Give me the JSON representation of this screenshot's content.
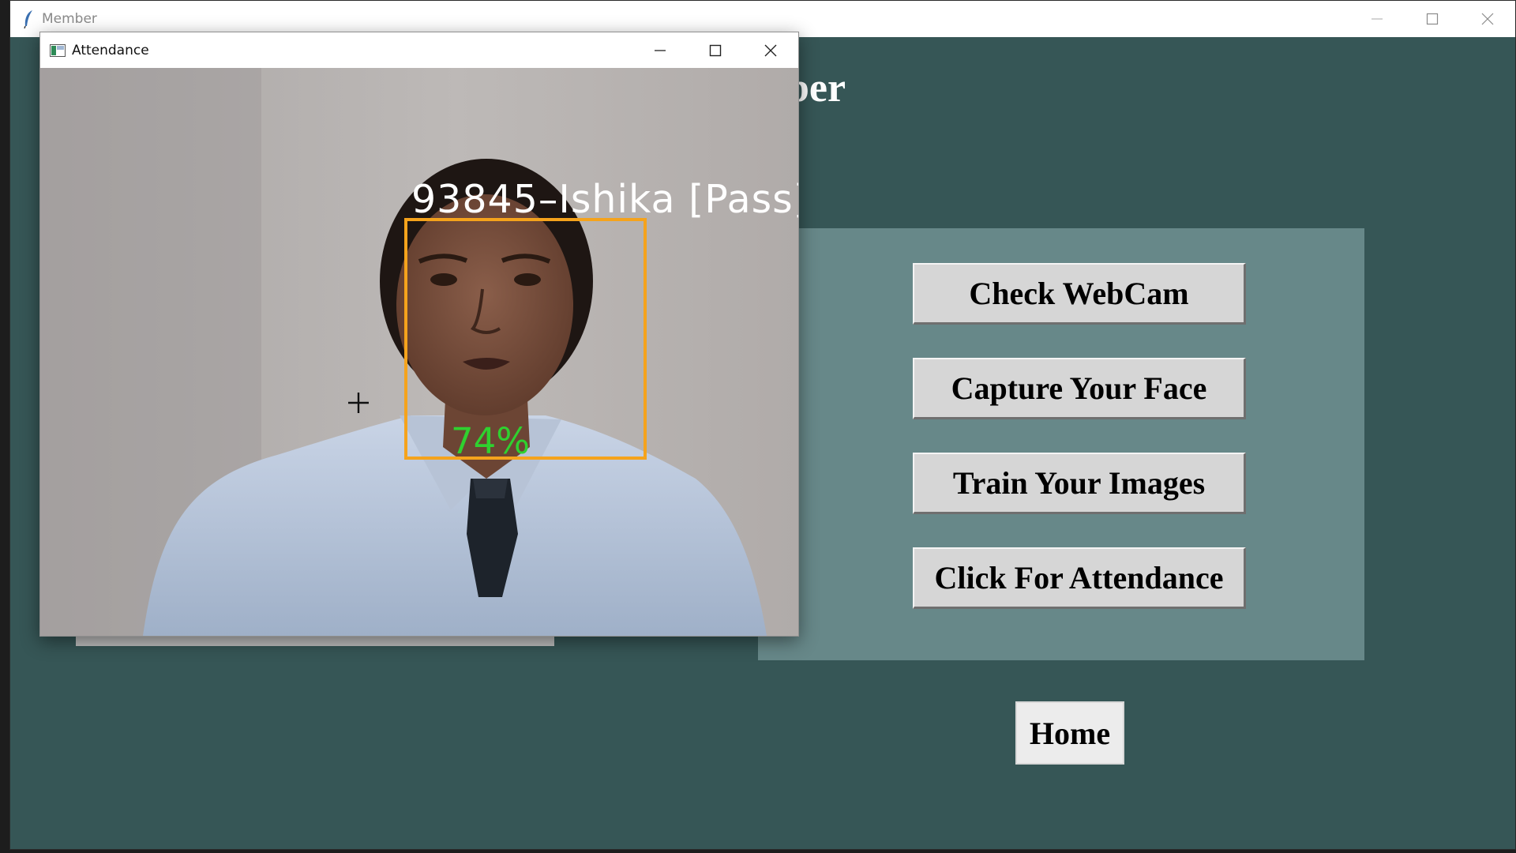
{
  "main_window": {
    "title": "Member",
    "heading": "ber"
  },
  "buttons": {
    "check_webcam": "Check WebCam",
    "capture_face": "Capture Your Face",
    "train_images": "Train Your Images",
    "attendance": "Click For Attendance",
    "home": "Home"
  },
  "attendance_window": {
    "title": "Attendance",
    "face_label": "93845–Ishika [Pass]",
    "confidence": "74%"
  },
  "icons": {
    "member_app": "feather-icon",
    "attendance_app": "window-image-icon",
    "minimize": "minimize-icon",
    "maximize": "maximize-icon",
    "close": "close-icon",
    "cursor": "crosshair-icon"
  },
  "colors": {
    "window_bg": "#365656",
    "panel_bg": "#678889",
    "button_bg": "#d6d6d6",
    "face_box": "#f5a31c",
    "confidence_text": "#2fd12f"
  }
}
